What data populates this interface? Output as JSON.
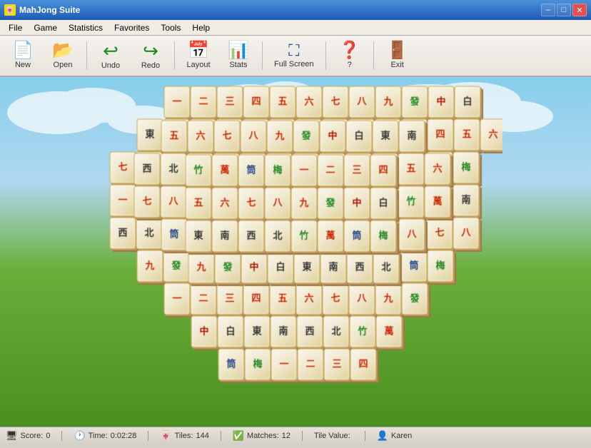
{
  "window": {
    "title": "MahJong Suite",
    "title_icon": "🀄"
  },
  "titlebar": {
    "minimize_label": "–",
    "maximize_label": "□",
    "close_label": "✕"
  },
  "menubar": {
    "items": [
      {
        "label": "File",
        "id": "file"
      },
      {
        "label": "Game",
        "id": "game"
      },
      {
        "label": "Statistics",
        "id": "statistics"
      },
      {
        "label": "Favorites",
        "id": "favorites"
      },
      {
        "label": "Tools",
        "id": "tools"
      },
      {
        "label": "Help",
        "id": "help"
      }
    ]
  },
  "toolbar": {
    "buttons": [
      {
        "id": "new",
        "label": "New",
        "icon": "📄"
      },
      {
        "id": "open",
        "label": "Open",
        "icon": "📂"
      },
      {
        "id": "undo",
        "label": "Undo",
        "icon": "↩"
      },
      {
        "id": "redo",
        "label": "Redo",
        "icon": "↪"
      },
      {
        "id": "layout",
        "label": "Layout",
        "icon": "📅"
      },
      {
        "id": "stats",
        "label": "Stats",
        "icon": "📊"
      },
      {
        "id": "fullscreen",
        "label": "Full Screen",
        "icon": "⛶"
      },
      {
        "id": "help",
        "label": "?",
        "icon": "❓"
      },
      {
        "id": "exit",
        "label": "Exit",
        "icon": "🚪"
      }
    ]
  },
  "statusbar": {
    "score_label": "Score:",
    "score_value": "0",
    "time_label": "Time:",
    "time_value": "0:02:28",
    "tiles_label": "Tiles:",
    "tiles_value": "144",
    "matches_label": "Matches:",
    "matches_value": "12",
    "tile_value_label": "Tile Value:",
    "tile_value": "",
    "user_label": "Karen"
  }
}
